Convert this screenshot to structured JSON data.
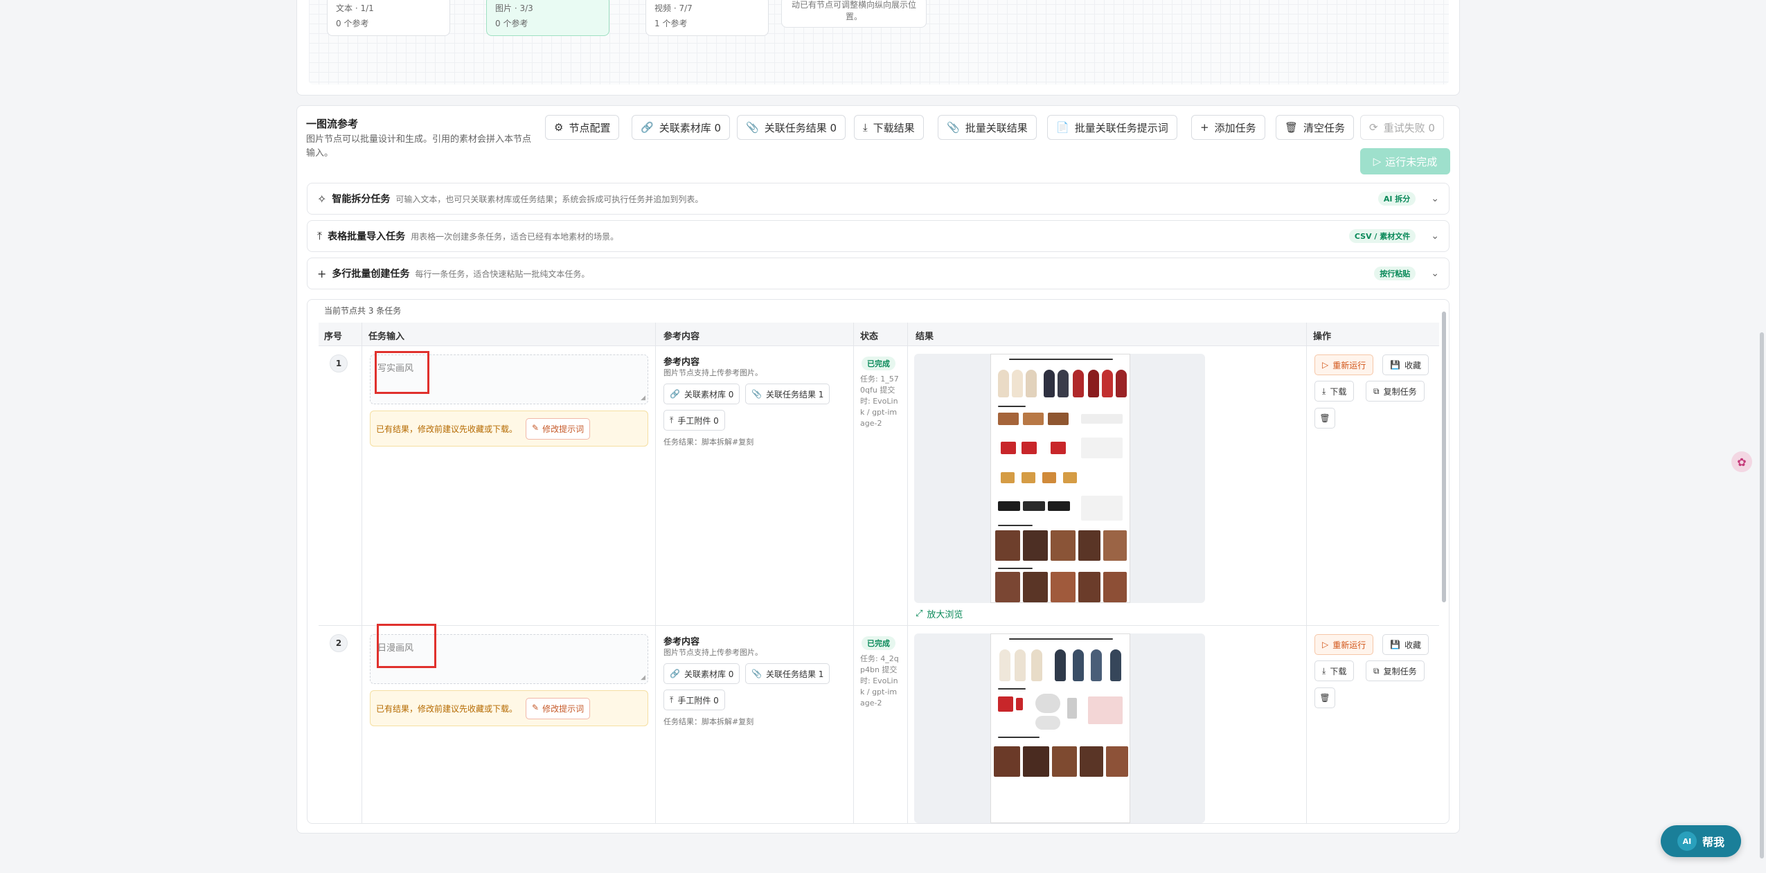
{
  "top_nodes": [
    {
      "line1": "文本 · 1/1",
      "line2": "0 个参考"
    },
    {
      "line1": "图片 · 3/3",
      "line2": "0 个参考"
    },
    {
      "line1": "视频 · 7/7",
      "line2": "1 个参考"
    }
  ],
  "top_hint": "动已有节点可调整横向纵向展示位置。",
  "section": {
    "title": "一图流参考",
    "desc": "图片节点可以批量设计和生成。引用的素材会拼入本节点输入。"
  },
  "toolbar": {
    "node_config": "节点配置",
    "link_library": "关联素材库 0",
    "link_results": "关联任务结果 0",
    "download": "下载结果",
    "batch_link": "批量关联结果",
    "batch_prompt": "批量关联任务提示词",
    "add_task": "添加任务",
    "clear_tasks": "清空任务",
    "retry_failed": "重试失败 0",
    "run": "运行未完成"
  },
  "collapsibles": [
    {
      "title": "智能拆分任务",
      "desc": "可输入文本，也可只关联素材库或任务结果；系统会拆成可执行任务并追加到列表。",
      "badge": "AI 拆分"
    },
    {
      "title": "表格批量导入任务",
      "desc": "用表格一次创建多条任务，适合已经有本地素材的场景。",
      "badge": "CSV / 素材文件"
    },
    {
      "title": "多行批量创建任务",
      "desc": "每行一条任务，适合快速粘贴一批纯文本任务。",
      "badge": "按行粘贴"
    }
  ],
  "table": {
    "count": "当前节点共 3 条任务",
    "headers": {
      "index": "序号",
      "input": "任务输入",
      "ref": "参考内容",
      "status": "状态",
      "result": "结果",
      "actions": "操作"
    },
    "rows": [
      {
        "index": "1",
        "input": "写实画风",
        "warn": "已有结果，修改前建议先收藏或下载。",
        "edit_prompt": "修改提示词",
        "ref_title": "参考内容",
        "ref_desc": "图片节点支持上传参考图片。",
        "ref_lib": "关联素材库 0",
        "ref_results": "关联任务结果 1",
        "ref_attach": "手工附件 0",
        "ref_source": "任务结果：脚本拆解#复刻",
        "status": "已完成",
        "meta": "任务: 1_570qfu 提交时: EvoLink / gpt-image-2",
        "zoom": "放大浏览",
        "rerun": "重新运行",
        "collect": "收藏",
        "download": "下载",
        "copy": "复制任务"
      },
      {
        "index": "2",
        "input": "日漫画风",
        "warn": "已有结果，修改前建议先收藏或下载。",
        "edit_prompt": "修改提示词",
        "ref_title": "参考内容",
        "ref_desc": "图片节点支持上传参考图片。",
        "ref_lib": "关联素材库 0",
        "ref_results": "关联任务结果 1",
        "ref_attach": "手工附件 0",
        "ref_source": "任务结果：脚本拆解#复刻",
        "status": "已完成",
        "meta": "任务: 4_2qp4bn 提交时: EvoLink / gpt-image-2",
        "rerun": "重新运行",
        "collect": "收藏",
        "download": "下载",
        "copy": "复制任务"
      }
    ]
  },
  "help": {
    "ai": "AI",
    "label": "帮我"
  },
  "colors": {
    "accent": "#0b8a5a",
    "highlight_box": "#e0312d",
    "help": "#1a7f99"
  }
}
